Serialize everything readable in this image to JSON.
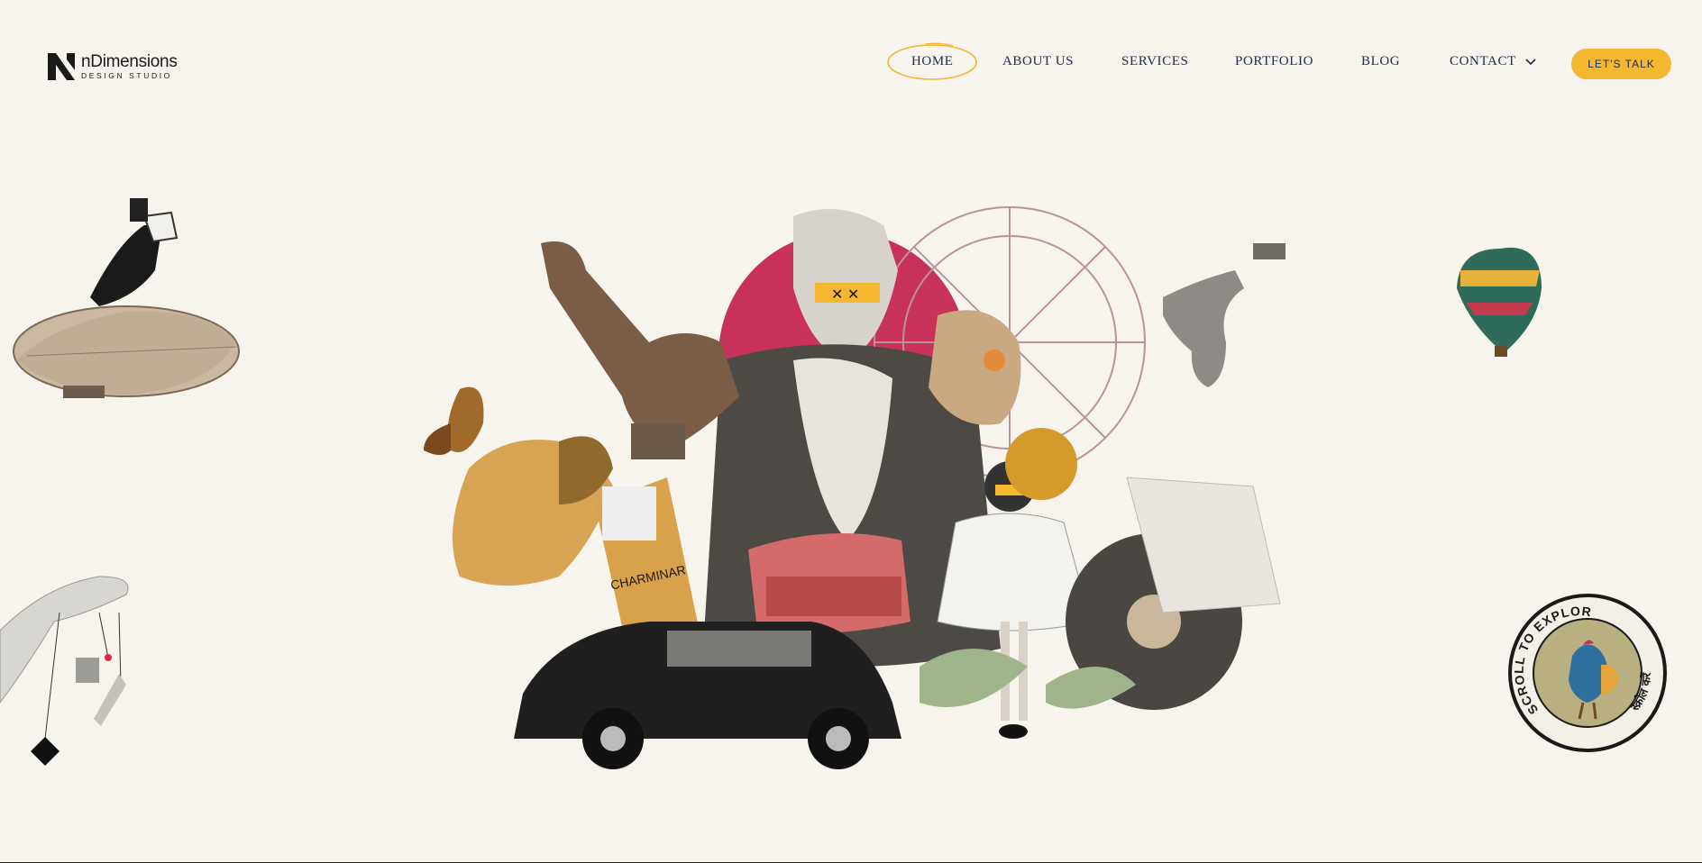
{
  "brand": {
    "name": "nDimensions",
    "tagline": "DESIGN STUDIO"
  },
  "nav": {
    "items": [
      {
        "label": "HOME"
      },
      {
        "label": "ABOUT US"
      },
      {
        "label": "SERVICES"
      },
      {
        "label": "PORTFOLIO"
      },
      {
        "label": "BLOG"
      },
      {
        "label": "CONTACT"
      }
    ],
    "active": "HOME",
    "cta_label": "LET'S TALK"
  },
  "scroll_badge": {
    "label": "SCROLL TO EXPLORE",
    "label_hindi": "स्क्रोल करें"
  },
  "colors": {
    "background": "#f7f3ed",
    "accent_yellow": "#f4b72f",
    "nav_text": "#1e2b4a",
    "sun_red": "#c8325a"
  },
  "icons": [
    "logo-mark",
    "chevron-down-icon",
    "rooster-icon"
  ]
}
